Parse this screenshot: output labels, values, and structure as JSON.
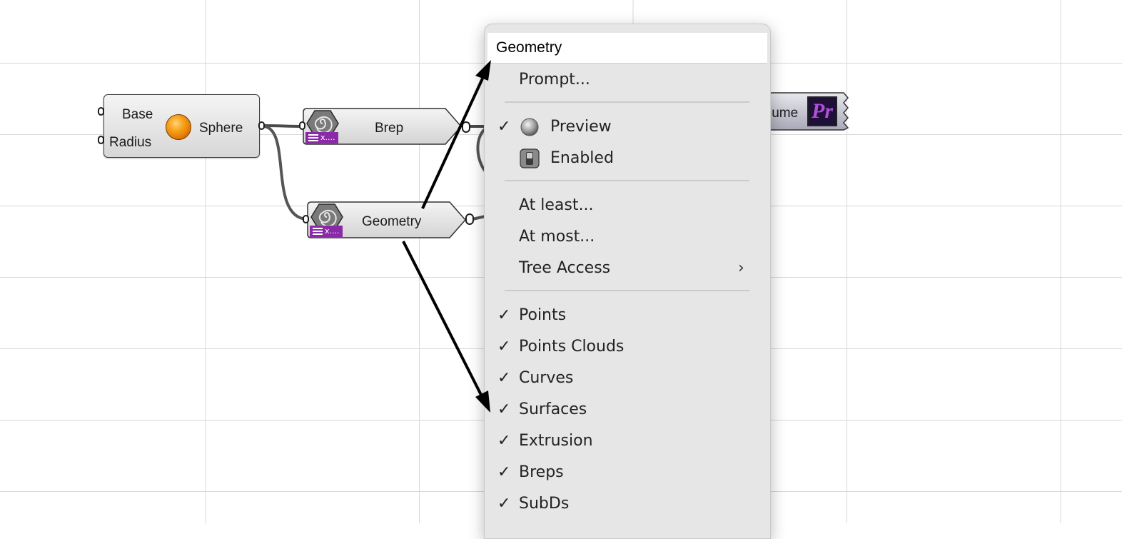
{
  "canvas": {
    "sphere": {
      "title": "Sphere",
      "inputs": [
        "Base",
        "Radius"
      ]
    },
    "brep_param": {
      "label": "Brep",
      "tag": "x...."
    },
    "geometry_param": {
      "label": "Geometry",
      "tag": "x...."
    },
    "volume_partial": {
      "label": "lume",
      "icon_text": "Pr"
    }
  },
  "context_menu": {
    "title": "Geometry",
    "items": [
      {
        "label": "Prompt...",
        "checked": false
      },
      {
        "label": "Preview",
        "checked": true,
        "icon": "preview-sphere-icon"
      },
      {
        "label": "Enabled",
        "checked": false,
        "icon": "enabled-toggle-icon"
      },
      {
        "label": "At least...",
        "checked": false
      },
      {
        "label": "At most...",
        "checked": false
      },
      {
        "label": "Tree Access",
        "checked": false,
        "submenu": true
      },
      {
        "label": "Points",
        "checked": true
      },
      {
        "label": "Points Clouds",
        "checked": true
      },
      {
        "label": "Curves",
        "checked": true
      },
      {
        "label": "Surfaces",
        "checked": true
      },
      {
        "label": "Extrusion",
        "checked": true
      },
      {
        "label": "Breps",
        "checked": true
      },
      {
        "label": "SubDs",
        "checked": true
      }
    ],
    "check_glyph": "✓",
    "submenu_glyph": "›"
  },
  "colors": {
    "tag_purple": "#8a2aa6",
    "menu_bg": "#e6e6e6",
    "grid_line": "#d8d8d8"
  }
}
